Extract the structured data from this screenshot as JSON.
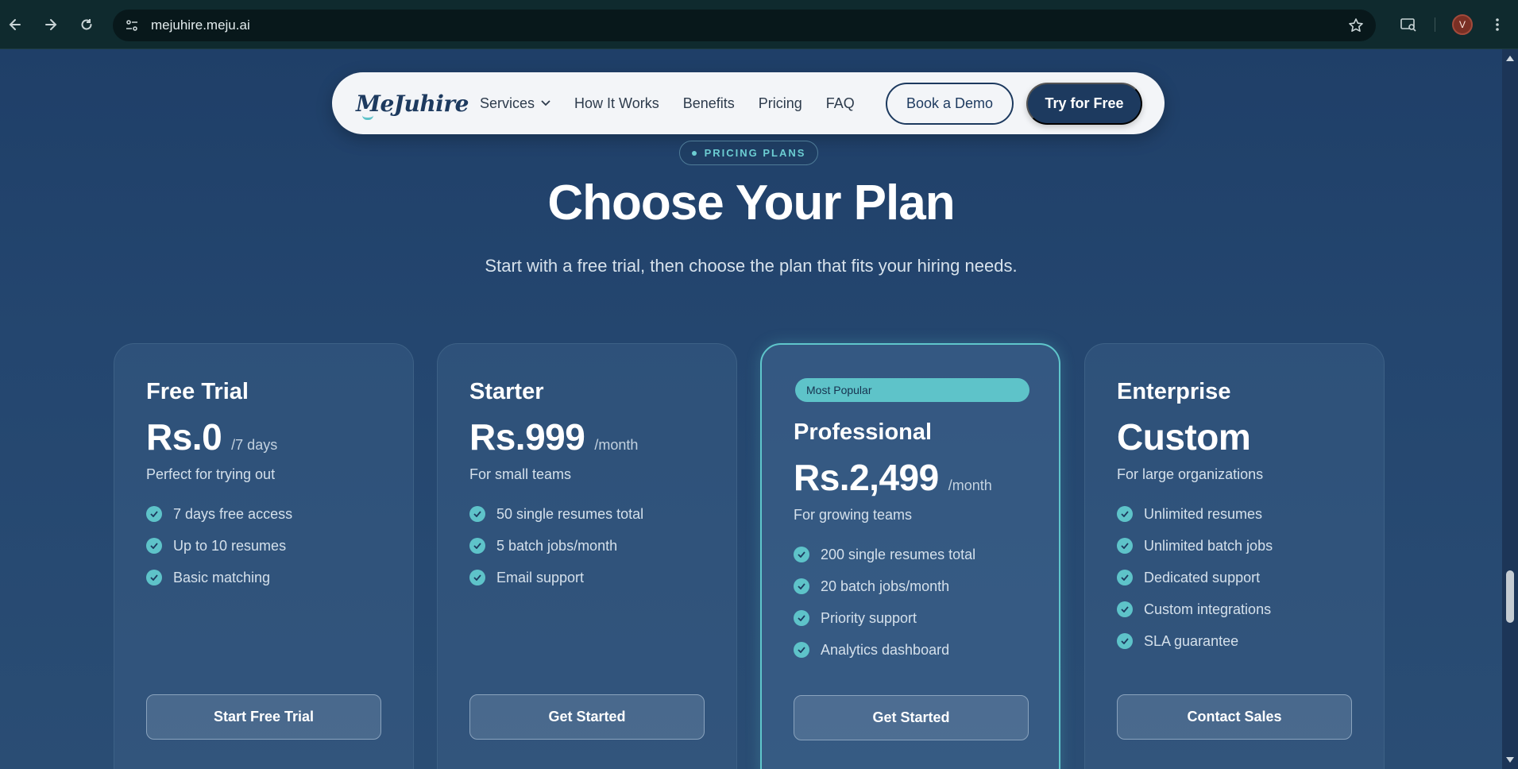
{
  "browser": {
    "url": "mejuhire.meju.ai",
    "avatar_initial": "V"
  },
  "navbar": {
    "logo": "MeJuhire",
    "links": [
      {
        "label": "Services"
      },
      {
        "label": "How It Works"
      },
      {
        "label": "Benefits"
      },
      {
        "label": "Pricing"
      },
      {
        "label": "FAQ"
      }
    ],
    "book_demo": "Book a Demo",
    "try_free": "Try for Free"
  },
  "hero": {
    "tag": "PRICING PLANS",
    "title": "Choose Your Plan",
    "subtitle": "Start with a free trial, then choose the plan that fits your hiring needs."
  },
  "plans": [
    {
      "name": "Free Trial",
      "price": "Rs.0",
      "period": "/7 days",
      "desc": "Perfect for trying out",
      "features": [
        "7 days free access",
        "Up to 10 resumes",
        "Basic matching"
      ],
      "cta": "Start Free Trial"
    },
    {
      "name": "Starter",
      "price": "Rs.999",
      "period": "/month",
      "desc": "For small teams",
      "features": [
        "50 single resumes total",
        "5 batch jobs/month",
        "Email support"
      ],
      "cta": "Get Started"
    },
    {
      "badge": "Most Popular",
      "name": "Professional",
      "price": "Rs.2,499",
      "period": "/month",
      "desc": "For growing teams",
      "features": [
        "200 single resumes total",
        "20 batch jobs/month",
        "Priority support",
        "Analytics dashboard"
      ],
      "cta": "Get Started"
    },
    {
      "name": "Enterprise",
      "price": "Custom",
      "period": "",
      "desc": "For large organizations",
      "features": [
        "Unlimited resumes",
        "Unlimited batch jobs",
        "Dedicated support",
        "Custom integrations",
        "SLA guarantee"
      ],
      "cta": "Contact Sales"
    }
  ],
  "colors": {
    "accent": "#5ec3c9",
    "navy": "#1d3a5f",
    "page_bg": "#24466f"
  }
}
